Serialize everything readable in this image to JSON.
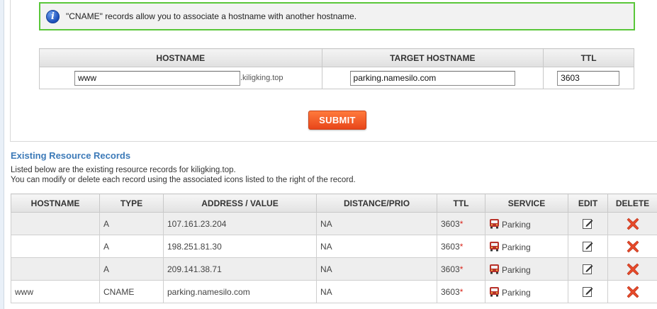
{
  "info": {
    "message": "\"CNAME\" records allow you to associate a hostname with another hostname."
  },
  "form": {
    "headers": {
      "hostname": "HOSTNAME",
      "target": "TARGET HOSTNAME",
      "ttl": "TTL"
    },
    "hostname_value": "www",
    "hostname_suffix": ".kiligking.top",
    "target_value": "parking.namesilo.com",
    "ttl_value": "3603",
    "submit_label": "SUBMIT"
  },
  "records": {
    "title": "Existing Resource Records",
    "desc_line1": "Listed below are the existing resource records for kiligking.top.",
    "desc_line2": "You can modify or delete each record using the associated icons listed to the right of the record.",
    "headers": {
      "hostname": "HOSTNAME",
      "type": "TYPE",
      "address": "ADDRESS / VALUE",
      "distance": "DISTANCE/PRIO",
      "ttl": "TTL",
      "service": "SERVICE",
      "edit": "EDIT",
      "delete": "DELETE"
    },
    "rows": [
      {
        "hostname": "",
        "type": "A",
        "address": "107.161.23.204",
        "distance": "NA",
        "ttl": "3603",
        "ttl_mark": "*",
        "service": "Parking"
      },
      {
        "hostname": "",
        "type": "A",
        "address": "198.251.81.30",
        "distance": "NA",
        "ttl": "3603",
        "ttl_mark": "*",
        "service": "Parking"
      },
      {
        "hostname": "",
        "type": "A",
        "address": "209.141.38.71",
        "distance": "NA",
        "ttl": "3603",
        "ttl_mark": "*",
        "service": "Parking"
      },
      {
        "hostname": "www",
        "type": "CNAME",
        "address": "parking.namesilo.com",
        "distance": "NA",
        "ttl": "3603",
        "ttl_mark": "*",
        "service": "Parking"
      }
    ],
    "icons": {
      "service": "bus-icon",
      "edit": "pencil-edit-icon",
      "delete": "red-x-delete-icon"
    }
  },
  "colors": {
    "info_border": "#5ac73a",
    "submit_bg": "#f05a24",
    "title": "#3c7ab8",
    "ttl_mark": "#d9261c",
    "delete_icon": "#e64a2a"
  }
}
